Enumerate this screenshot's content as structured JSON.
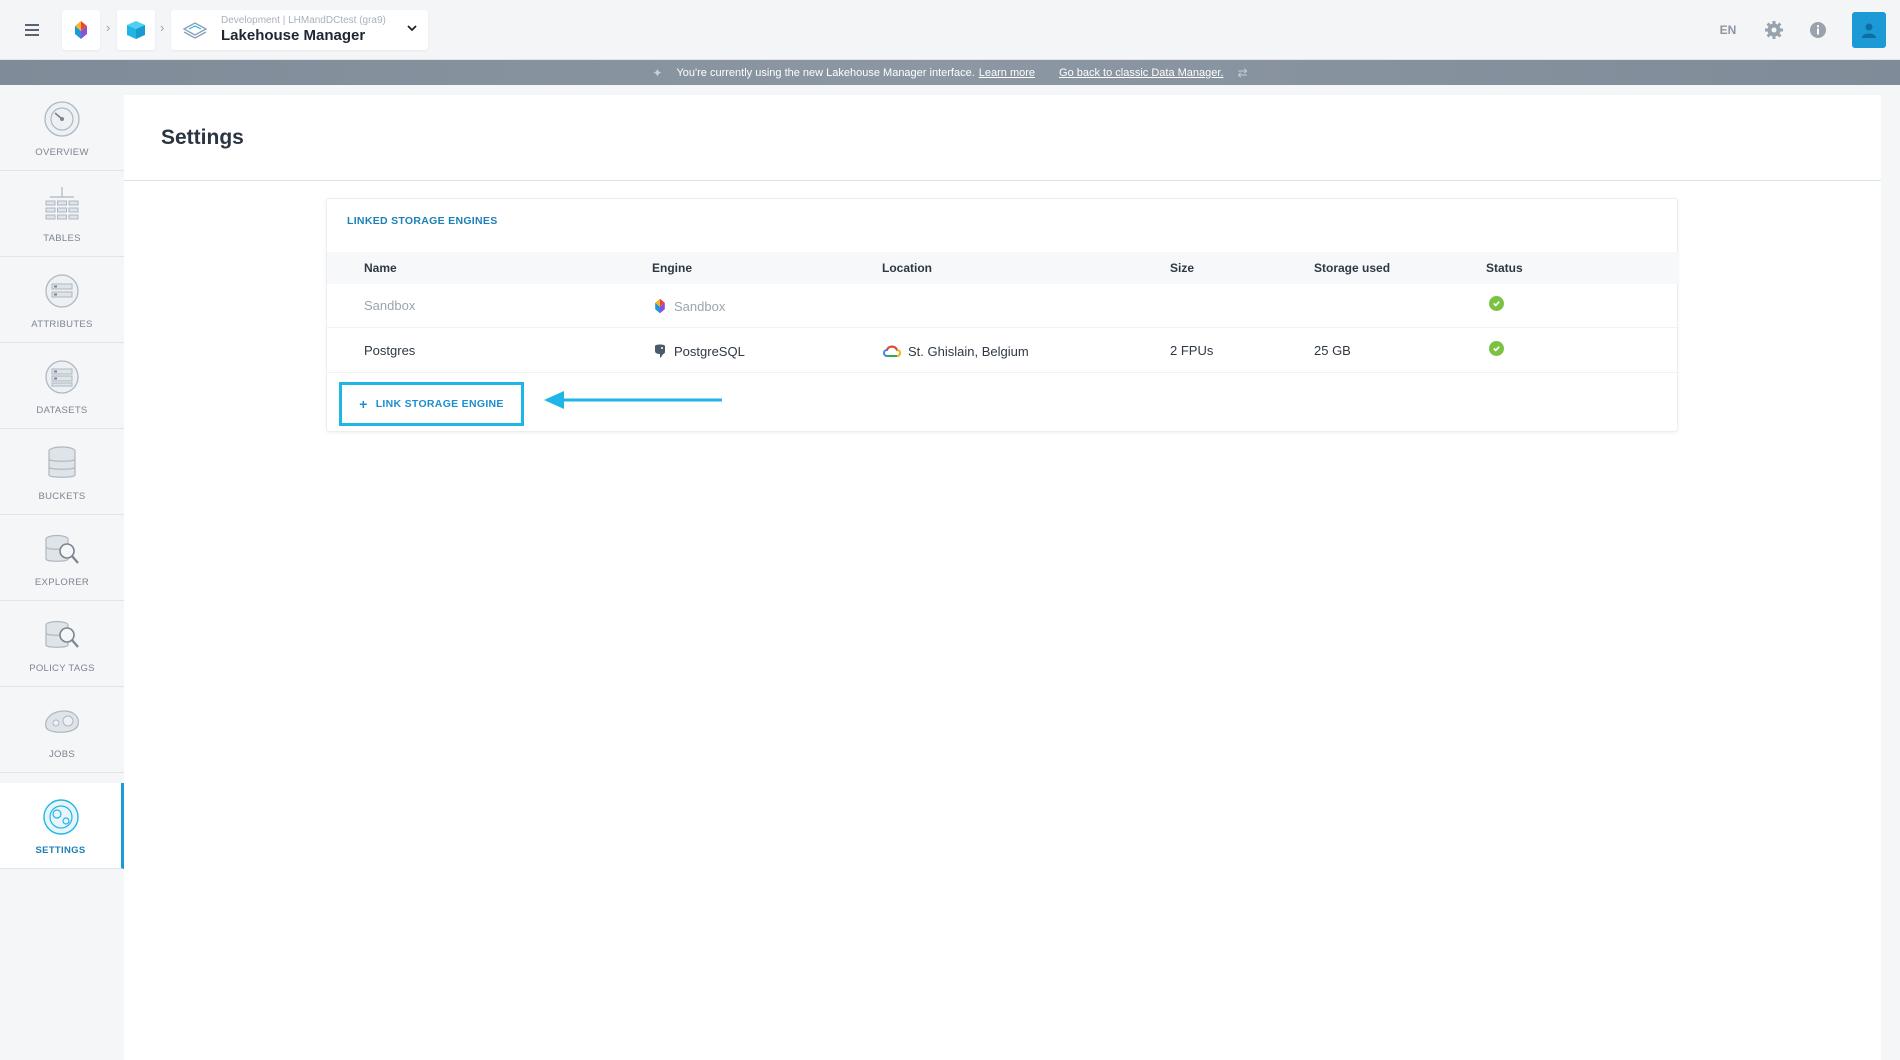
{
  "topbar": {
    "project_subtitle": "Development | LHMandDCtest (gra9)",
    "project_title": "Lakehouse Manager",
    "language": "EN",
    "icons": {
      "menu": "hamburger-icon",
      "org": "forepaas-logo-icon",
      "cube": "cube-icon",
      "lakehouse": "lakehouse-icon",
      "settings": "gear-icon",
      "info": "info-icon",
      "user": "user-avatar-icon"
    }
  },
  "banner": {
    "message": "You're currently using the new Lakehouse Manager interface.",
    "learn_more": "Learn more",
    "classic_link": "Go back to classic Data Manager."
  },
  "sidebar": {
    "items": [
      {
        "label": "OVERVIEW",
        "icon": "overview-gauge-icon"
      },
      {
        "label": "TABLES",
        "icon": "tables-icon"
      },
      {
        "label": "ATTRIBUTES",
        "icon": "attributes-icon"
      },
      {
        "label": "DATASETS",
        "icon": "datasets-icon"
      },
      {
        "label": "BUCKETS",
        "icon": "buckets-icon"
      },
      {
        "label": "EXPLORER",
        "icon": "explorer-icon"
      },
      {
        "label": "POLICY TAGS",
        "icon": "policy-tags-icon"
      },
      {
        "label": "JOBS",
        "icon": "jobs-icon"
      },
      {
        "label": "SETTINGS",
        "icon": "settings-icon",
        "active": true
      }
    ]
  },
  "page": {
    "title": "Settings"
  },
  "storage": {
    "title": "LINKED STORAGE ENGINES",
    "columns": [
      "Name",
      "Engine",
      "Location",
      "Size",
      "Storage used",
      "Status"
    ],
    "rows": [
      {
        "name": "Sandbox",
        "engine": "Sandbox",
        "location": "",
        "size": "",
        "storage_used": "",
        "status": "ok"
      },
      {
        "name": "Postgres",
        "engine": "PostgreSQL",
        "location": "St. Ghislain, Belgium",
        "size": "2 FPUs",
        "storage_used": "25 GB",
        "status": "ok"
      }
    ],
    "link_button": "LINK STORAGE ENGINE"
  },
  "colors": {
    "accent": "#1c9ad6",
    "highlight": "#1fb6e6",
    "status_ok": "#7cc242"
  }
}
